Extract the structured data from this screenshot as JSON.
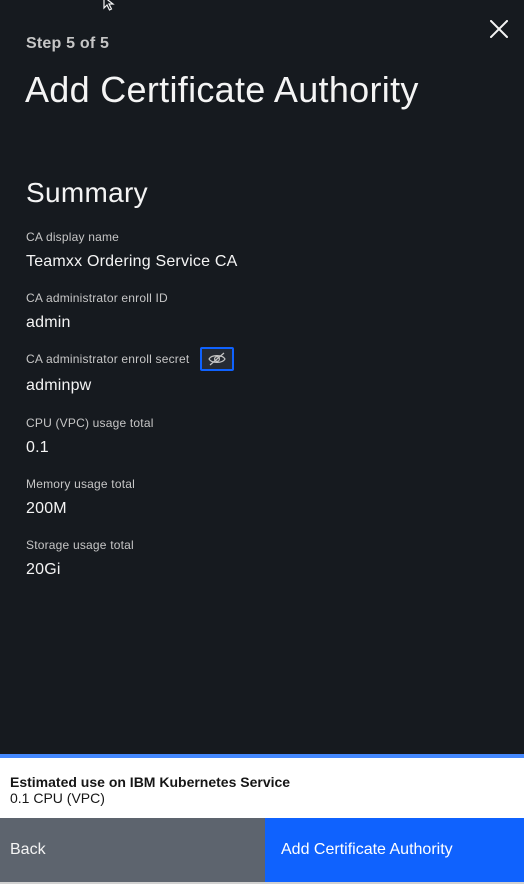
{
  "header": {
    "step": "Step 5 of 5",
    "title": "Add Certificate Authority"
  },
  "summary": {
    "title": "Summary",
    "fields": [
      {
        "label": "CA display name",
        "value": "Teamxx Ordering Service CA"
      },
      {
        "label": "CA administrator enroll ID",
        "value": "admin"
      },
      {
        "label": "CA administrator enroll secret",
        "value": "adminpw"
      },
      {
        "label": "CPU (VPC) usage total",
        "value": "0.1"
      },
      {
        "label": "Memory usage total",
        "value": "200M"
      },
      {
        "label": "Storage usage total",
        "value": "20Gi"
      }
    ]
  },
  "estimate": {
    "title": "Estimated use on IBM Kubernetes Service",
    "value": "0.1 CPU (VPC)"
  },
  "footer": {
    "back_label": "Back",
    "submit_label": "Add Certificate Authority"
  },
  "icons": {
    "close": "close-icon",
    "secret_toggle": "eye-slash-icon",
    "cursor": "mouse-cursor-icon"
  },
  "colors": {
    "background": "#161a1f",
    "primary": "#0f62fe",
    "focus": "#0f62fe",
    "secondary_button": "#5d646e",
    "estimate_border": "#4589ff"
  }
}
